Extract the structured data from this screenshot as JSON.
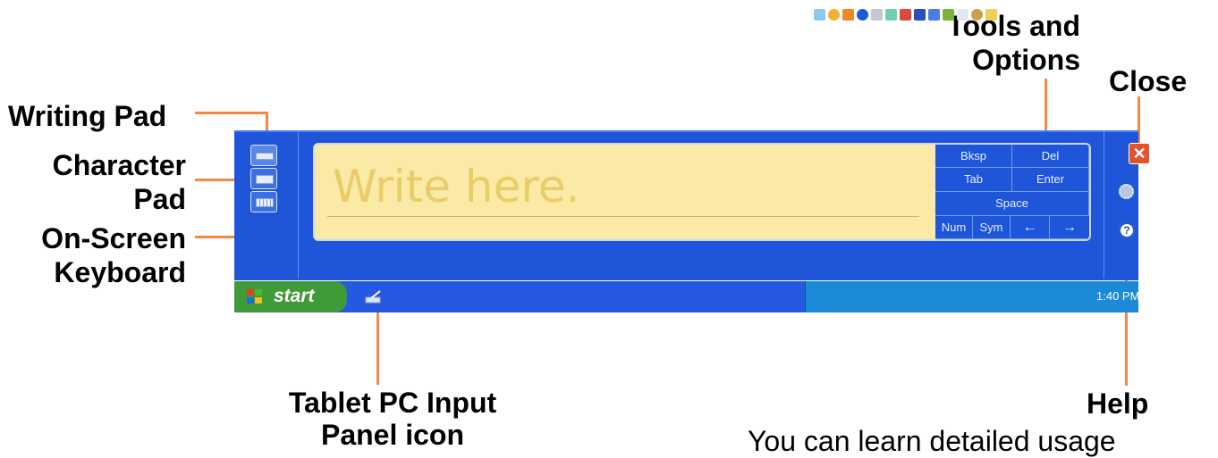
{
  "callouts": {
    "writing_pad": "Writing Pad",
    "character_pad": "Character\nPad",
    "on_screen_keyboard": "On-Screen\nKeyboard",
    "tools_and_options": "Tools and\nOptions",
    "close": "Close",
    "tablet_pc_input_panel_icon": "Tablet PC Input\nPanel icon",
    "help": "Help"
  },
  "write_area": {
    "placeholder": "Write here."
  },
  "keys": {
    "bksp": "Bksp",
    "del": "Del",
    "tab": "Tab",
    "enter": "Enter",
    "space": "Space",
    "num": "Num",
    "sym": "Sym",
    "left_arrow": "←",
    "right_arrow": "→"
  },
  "close_glyph": "✕",
  "help_glyph": "?",
  "taskbar": {
    "start_label": "start",
    "clock": "1:40 PM"
  },
  "icons": [
    "writing-pad-icon",
    "character-pad-icon",
    "keyboard-icon",
    "close-icon",
    "gear-icon",
    "help-icon",
    "windows-logo-icon",
    "tablet-input-panel-icon"
  ],
  "colors": {
    "callout_line": "#f08a45",
    "panel_blue": "#1f56d9",
    "write_area": "#fbe9a6",
    "start_green": "#3f9a38",
    "tray_blue": "#1b8ad9"
  },
  "bottom_text": "You can learn detailed usage"
}
